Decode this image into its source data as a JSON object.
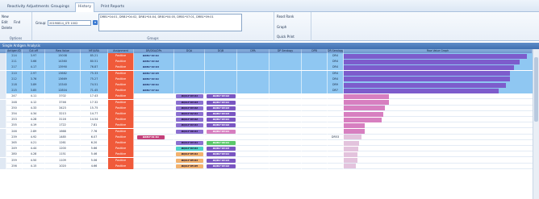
{
  "tabs": [
    "Reactivity Adjustments",
    "Groupings",
    "History",
    "Print Reports"
  ],
  "active_tab": "History",
  "ribbon": {
    "options_items": [
      "New",
      "Edit",
      "Delete"
    ],
    "find_label": "Find",
    "options_label": "Options",
    "groups_label": "Groups",
    "group_field_label": "Group:",
    "group_value": "20190814_GTI 1002",
    "group_list_text": "DRB1*04:01, DRB1*04:02, DRB1*04:04, DRB1*04:05, DRB1*07:01, DRB1*09:01",
    "quick_items": [
      "Read Rank",
      "Graph",
      "Quick Print"
    ]
  },
  "panel_title": "Single Antigen Analysis",
  "columns": [
    "Antigen ID",
    "Cut off",
    "Raw Value",
    "MFI/LRA",
    "Assignment",
    "DR/DSA/DPs",
    "DQA",
    "DQB",
    "DPA",
    "DP Serology",
    "DPB",
    "DR Serology",
    "Raw Value Graph"
  ],
  "rows": [
    {
      "id": "214",
      "cutoff": "3.97",
      "raw": "15008",
      "mfi": "85.21",
      "assign": "Positive",
      "dr": "DRB1*04:01",
      "dqa": "",
      "dqb": "",
      "drs": "DR4",
      "pct": 0.97
    },
    {
      "id": "211",
      "cutoff": "3.66",
      "raw": "14360",
      "mfi": "80.51",
      "assign": "Positive",
      "dr": "DRB1*04:02",
      "dqa": "",
      "dqb": "",
      "drs": "DR4",
      "pct": 0.93
    },
    {
      "id": "217",
      "cutoff": "4.17",
      "raw": "13990",
      "mfi": "76.87",
      "assign": "Positive",
      "dr": "DRB1*04:04",
      "dqa": "",
      "dqb": "",
      "drs": "DR4",
      "pct": 0.9
    },
    {
      "id": "210",
      "cutoff": "2.97",
      "raw": "13682",
      "mfi": "75.33",
      "assign": "Positive",
      "dr": "DRB1*04:05",
      "dqa": "",
      "dqb": "",
      "drs": "DR4",
      "pct": 0.88
    },
    {
      "id": "212",
      "cutoff": "3.76",
      "raw": "13669",
      "mfi": "75.27",
      "assign": "Positive",
      "dr": "DRB1*04:01",
      "dqa": "",
      "dqb": "",
      "drs": "DR4",
      "pct": 0.88
    },
    {
      "id": "218",
      "cutoff": "3.89",
      "raw": "13340",
      "mfi": "74.51",
      "assign": "Positive",
      "dr": "DRB1*09:01",
      "dqa": "",
      "dqb": "",
      "drs": "DR9",
      "pct": 0.86
    },
    {
      "id": "215",
      "cutoff": "3.85",
      "raw": "12804",
      "mfi": "71.45",
      "assign": "Positive",
      "dr": "DRB1*07:01",
      "dqa": "",
      "dqb": "",
      "drs": "DR7",
      "pct": 0.82
    },
    {
      "id": "247",
      "cutoff": "4.11",
      "raw": "3702",
      "mfi": "17.43",
      "assign": "Positive",
      "dr": "",
      "dqa": "DQA1*03:01",
      "dqb": "DQB1*03:02",
      "drs": "",
      "pct": 0.24
    },
    {
      "id": "248",
      "cutoff": "4.12",
      "raw": "3746",
      "mfi": "17.32",
      "assign": "Positive",
      "dr": "",
      "dqa": "DQA1*03:03",
      "dqb": "DQB1*03:01",
      "drs": "",
      "pct": 0.24
    },
    {
      "id": "250",
      "cutoff": "4.33",
      "raw": "3423",
      "mfi": "15.75",
      "assign": "Positive",
      "dr": "",
      "dqa": "DQA1*03:02",
      "dqb": "DQB1*03:03",
      "drs": "",
      "pct": 0.22
    },
    {
      "id": "254",
      "cutoff": "4.34",
      "raw": "3213",
      "mfi": "14.77",
      "assign": "Positive",
      "dr": "",
      "dqa": "DQA1*02:01",
      "dqb": "DQB1*03:03",
      "drs": "",
      "pct": 0.21
    },
    {
      "id": "253",
      "cutoff": "4.28",
      "raw": "3116",
      "mfi": "14.54",
      "assign": "Positive",
      "dr": "",
      "dqa": "DQA1*03:02",
      "dqb": "DQB1*03:01",
      "drs": "",
      "pct": 0.2
    },
    {
      "id": "255",
      "cutoff": "4.19",
      "raw": "1722",
      "mfi": "7.81",
      "assign": "Positive",
      "dr": "",
      "dqa": "DQA1*04:01",
      "dqb": "DQB1*04:02",
      "drs": "",
      "pct": 0.11
    },
    {
      "id": "246",
      "cutoff": "2.89",
      "raw": "1668",
      "mfi": "7.76",
      "assign": "Positive",
      "dr": "",
      "dqa": "DQA1*06:01",
      "dqb": "DQB1*03:01",
      "drs": "",
      "pct": 0.11
    },
    {
      "id": "239",
      "cutoff": "4.92",
      "raw": "1485",
      "mfi": "6.07",
      "assign": "Positive",
      "dr": "DRB4*01:01",
      "dqa": "",
      "dqb": "",
      "drs": "DR53",
      "pct": 0.095
    },
    {
      "id": "265",
      "cutoff": "4.21",
      "raw": "1261",
      "mfi": "6.20",
      "assign": "Positive",
      "dr": "",
      "dqa": "DQA1*03:01",
      "dqb": "DQB1*06:01",
      "drs": "",
      "pct": 0.08
    },
    {
      "id": "249",
      "cutoff": "4.44",
      "raw": "1200",
      "mfi": "5.66",
      "assign": "Positive",
      "dr": "",
      "dqa": "DQA1*04:01",
      "dqb": "DQB1*03:03",
      "drs": "",
      "pct": 0.077
    },
    {
      "id": "280",
      "cutoff": "4.28",
      "raw": "1151",
      "mfi": "5.46",
      "assign": "Positive",
      "dr": "",
      "dqa": "DQA1*05:01",
      "dqb": "DQB1*03:01",
      "drs": "",
      "pct": 0.074
    },
    {
      "id": "259",
      "cutoff": "4.50",
      "raw": "1109",
      "mfi": "5.06",
      "assign": "Positive",
      "dr": "",
      "dqa": "DQA1*05:01",
      "dqb": "DQB1*03:03",
      "drs": "",
      "pct": 0.071
    },
    {
      "id": "256",
      "cutoff": "4.15",
      "raw": "1020",
      "mfi": "4.66",
      "assign": "Positive",
      "dr": "",
      "dqa": "DQA1*05:05",
      "dqb": "DQB1*03:02",
      "drs": "",
      "pct": 0.065
    }
  ],
  "colors": {
    "row_blue": "#8fc7f2",
    "row_white": "#ffffff",
    "positive": "#f05a3a",
    "dr_pill": "#1f2f66",
    "dr_pill_pink": "#c4407a",
    "dqa_purple": "#8b6fd0",
    "dqb_purple": "#7a56c2",
    "dqa_orange": "#f2b26e",
    "dqa_teal": "#4fd2c8",
    "dqb_green": "#5bc86a",
    "bar_purple": "#7d5ccc",
    "bar_pink": "#d77fc0"
  }
}
